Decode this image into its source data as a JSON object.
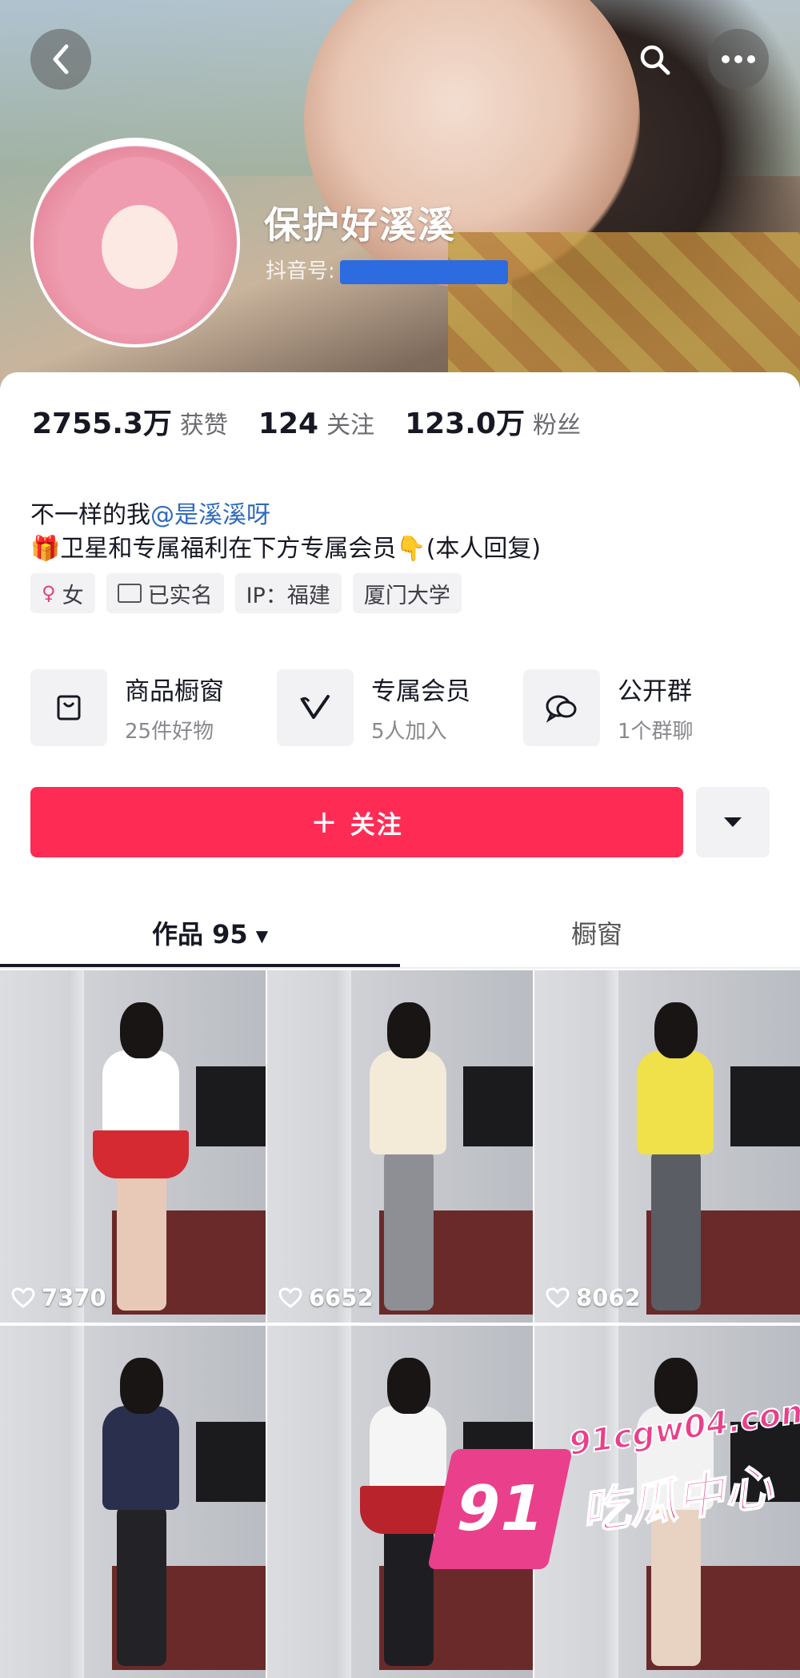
{
  "profile": {
    "username": "保护好溪溪",
    "handle_label": "抖音号:"
  },
  "stats": [
    {
      "value": "2755.3万",
      "label": "获赞"
    },
    {
      "value": "124",
      "label": "关注"
    },
    {
      "value": "123.0万",
      "label": "粉丝"
    }
  ],
  "bio": {
    "line1_prefix": "不一样的我",
    "line1_mention": "@是溪溪呀",
    "line2_emoji": "🎁",
    "line2_text": "卫星和专属福利在下方专属会员",
    "line2_emoji2": "👇",
    "line2_suffix": "(本人回复)"
  },
  "tags": [
    {
      "icon": "female-icon",
      "glyph": "♀",
      "label": "女"
    },
    {
      "icon": "id-card-icon",
      "label": "已实名"
    },
    {
      "label": "IP：福建"
    },
    {
      "label": "厦门大学"
    }
  ],
  "services": [
    {
      "icon": "shopping-bag-icon",
      "title": "商品橱窗",
      "subtitle": "25件好物"
    },
    {
      "icon": "vip-v-icon",
      "title": "专属会员",
      "subtitle": "5人加入"
    },
    {
      "icon": "group-chat-icon",
      "title": "公开群",
      "subtitle": "1个群聊"
    }
  ],
  "follow_button": {
    "plus": "+",
    "label": "关注"
  },
  "tabs": {
    "works_label": "作品 95",
    "works_arrow": "▼",
    "shop_label": "橱窗"
  },
  "videos": [
    {
      "likes": "7370",
      "top": "#ffffff",
      "legs": "#e8c9b8",
      "skirt": "#d62a32"
    },
    {
      "likes": "6652",
      "top": "#f3ead8",
      "legs": "#8d8f94",
      "skirt": ""
    },
    {
      "likes": "8062",
      "top": "#f0e04a",
      "legs": "#5a5d63",
      "skirt": ""
    },
    {
      "likes": "",
      "top": "#2a2f4d",
      "legs": "#232327",
      "skirt": ""
    },
    {
      "likes": "",
      "top": "#f5f5f5",
      "legs": "#1e1e22",
      "skirt": "#b8232c"
    },
    {
      "likes": "",
      "top": "#f2f2f2",
      "legs": "#e8d2c2",
      "skirt": ""
    }
  ],
  "watermark": {
    "number": "91",
    "url": "91cgw04.com",
    "text": "吃瓜中心"
  },
  "colors": {
    "follow": "#fe2c55",
    "mention": "#2f6bbd",
    "watermark": "#ea3f8b"
  }
}
